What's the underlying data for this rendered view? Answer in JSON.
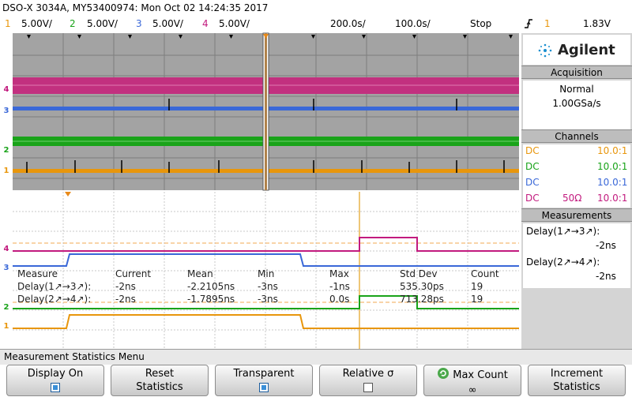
{
  "header": {
    "title": "DSO-X 3034A, MY53400974: Mon Oct 02 14:24:35 2017",
    "channels": [
      {
        "num": "1",
        "scale": "5.00V/"
      },
      {
        "num": "2",
        "scale": "5.00V/"
      },
      {
        "num": "3",
        "scale": "5.00V/"
      },
      {
        "num": "4",
        "scale": "5.00V/"
      }
    ],
    "timebase": "200.0s/",
    "delay": "100.0s/",
    "run_state": "Stop",
    "trigger_icon": "rising-edge-icon",
    "trigger_channel": "1",
    "trigger_level": "1.83V"
  },
  "markers": {
    "ch1": "1",
    "ch2": "2",
    "ch3": "3",
    "ch4": "4",
    "t_label": "T"
  },
  "panel": {
    "logo": "Agilent",
    "acquisition": {
      "title": "Acquisition",
      "mode": "Normal",
      "rate": "1.00GSa/s"
    },
    "channels": {
      "title": "Channels",
      "rows": [
        {
          "coupling": "DC",
          "imp": "",
          "probe": "10.0:1"
        },
        {
          "coupling": "DC",
          "imp": "",
          "probe": "10.0:1"
        },
        {
          "coupling": "DC",
          "imp": "",
          "probe": "10.0:1"
        },
        {
          "coupling": "DC",
          "imp": "50Ω",
          "probe": "10.0:1"
        }
      ]
    },
    "measurements": {
      "title": "Measurements",
      "items": [
        {
          "label": "Delay(1↗→3↗):",
          "value": "-2ns"
        },
        {
          "label": "Delay(2↗→4↗):",
          "value": "-2ns"
        }
      ]
    }
  },
  "stats": {
    "headers": [
      "Measure",
      "Current",
      "Mean",
      "Min",
      "Max",
      "Std Dev",
      "Count"
    ],
    "rows": [
      [
        "Delay(1↗→3↗):",
        "-2ns",
        "-2.2105ns",
        "-3ns",
        "-1ns",
        "535.30ps",
        "19"
      ],
      [
        "Delay(2↗→4↗):",
        "-2ns",
        "-1.7895ns",
        "-3ns",
        "0.0s",
        "713.28ps",
        "19"
      ]
    ]
  },
  "menu": {
    "title": "Measurement Statistics Menu",
    "buttons": [
      {
        "line1": "Display On",
        "line2": "",
        "checked": true
      },
      {
        "line1": "Reset",
        "line2": "Statistics"
      },
      {
        "line1": "Transparent",
        "line2": "",
        "checked": true
      },
      {
        "line1": "Relative σ",
        "line2": "",
        "checked": false
      },
      {
        "line1": "Max Count",
        "line2": "∞",
        "icon": "refresh-icon"
      },
      {
        "line1": "Increment",
        "line2": "Statistics"
      }
    ]
  },
  "colors": {
    "ch1": "#e8960c",
    "ch2": "#19a319",
    "ch3": "#3a68d8",
    "ch4": "#c21a7e"
  }
}
